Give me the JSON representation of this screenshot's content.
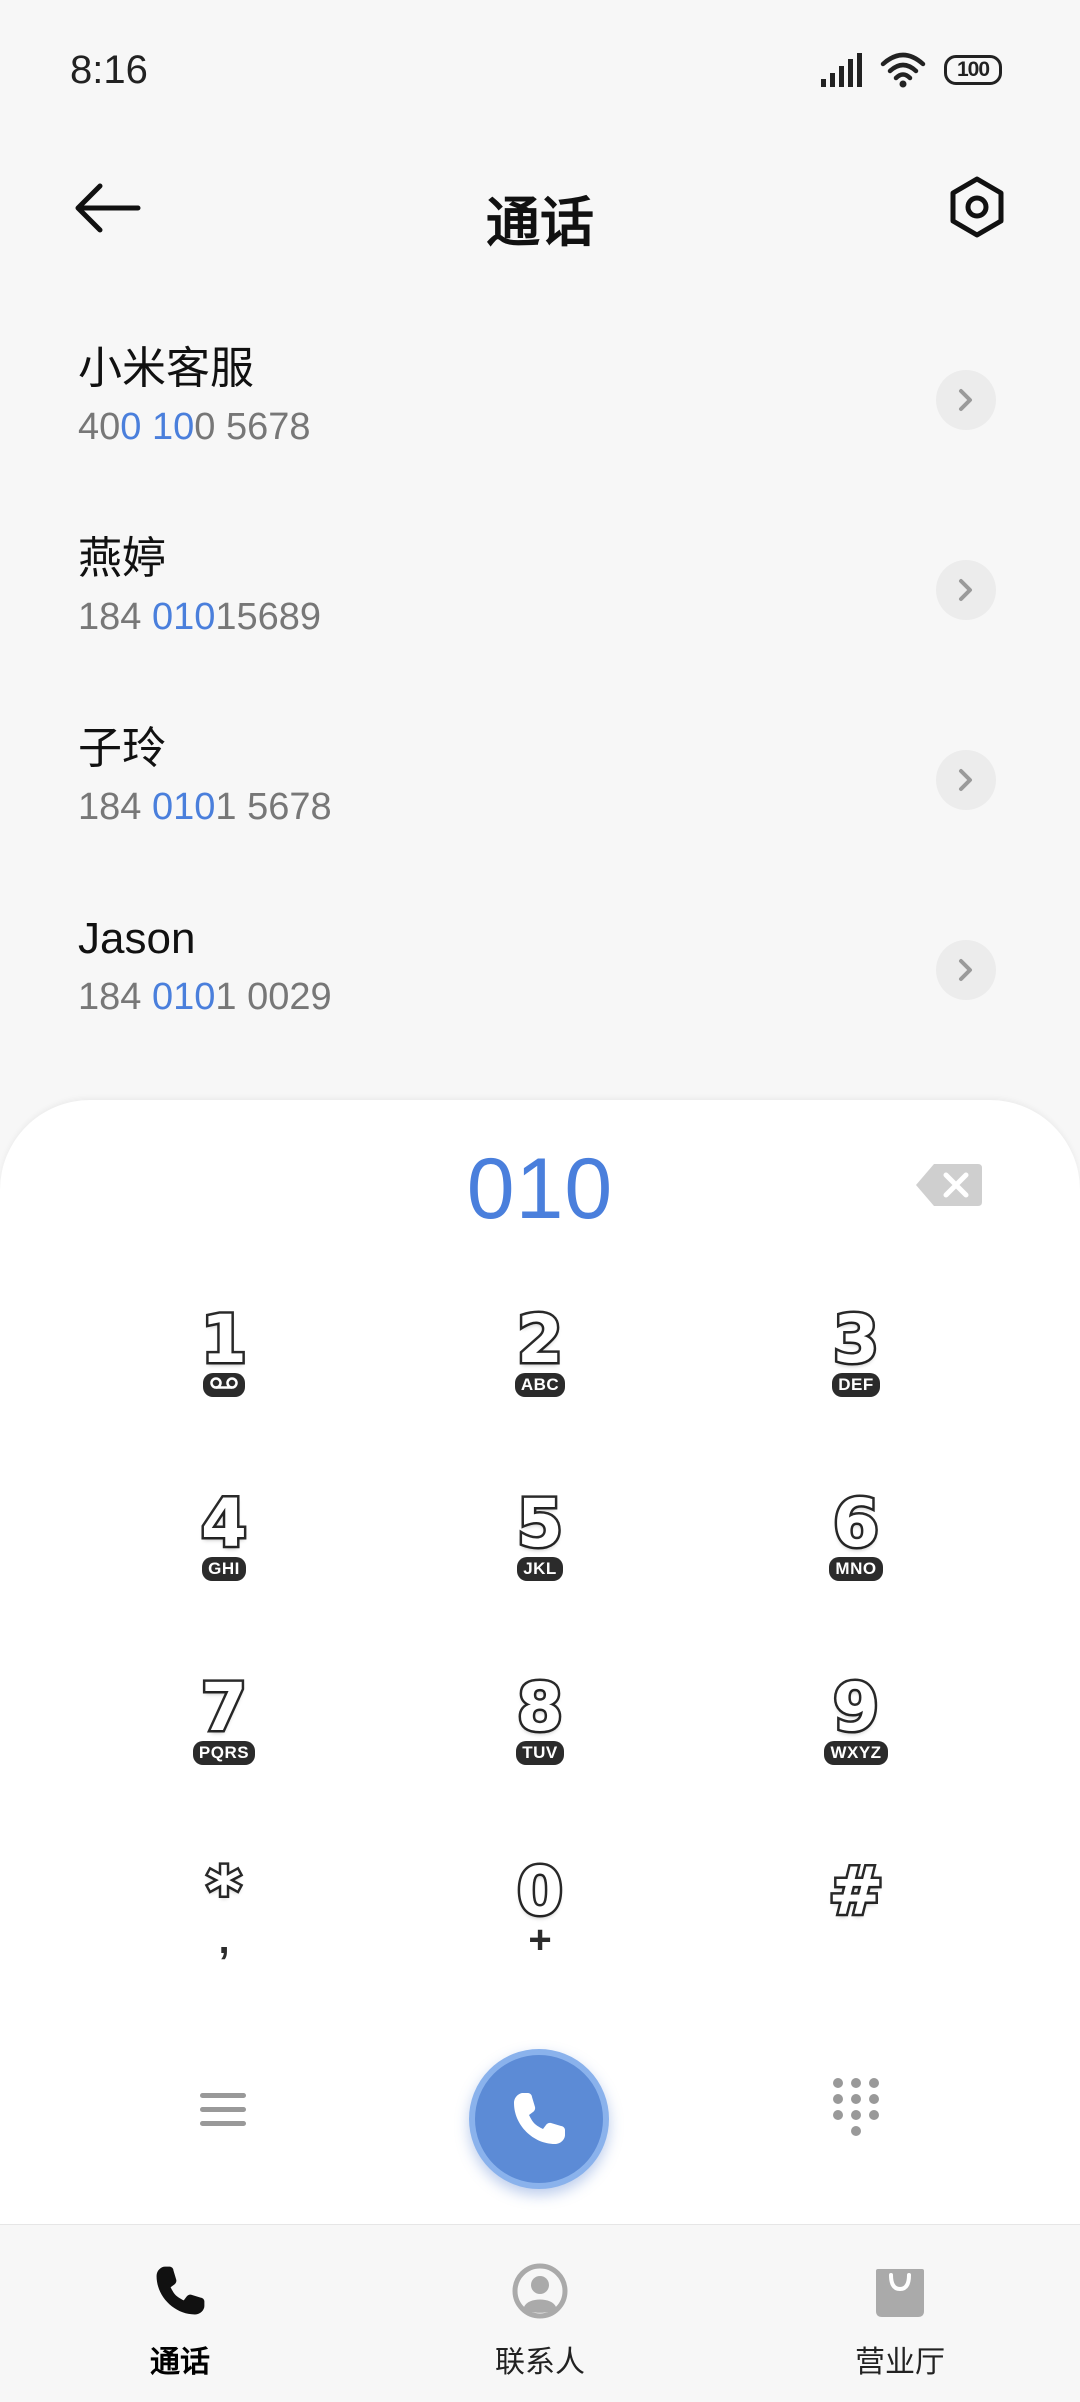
{
  "status_bar": {
    "time": "8:16",
    "battery": "100"
  },
  "header": {
    "title": "通话"
  },
  "results": [
    {
      "name": "小米客服",
      "number_parts": [
        "40",
        "0 10",
        "0 5678"
      ]
    },
    {
      "name": "燕婷",
      "number_parts": [
        "184 ",
        "010",
        "15689"
      ]
    },
    {
      "name": "子玲",
      "number_parts": [
        "184 ",
        "010",
        "1 5678"
      ]
    },
    {
      "name": "Jason",
      "number_parts": [
        "184 ",
        "010",
        "1 0029"
      ]
    }
  ],
  "dialer": {
    "input": "010",
    "keys": [
      {
        "digit": "1",
        "letters": "",
        "icon": "voicemail-icon"
      },
      {
        "digit": "2",
        "letters": "ABC"
      },
      {
        "digit": "3",
        "letters": "DEF"
      },
      {
        "digit": "4",
        "letters": "GHI"
      },
      {
        "digit": "5",
        "letters": "JKL"
      },
      {
        "digit": "6",
        "letters": "MNO"
      },
      {
        "digit": "7",
        "letters": "PQRS"
      },
      {
        "digit": "8",
        "letters": "TUV"
      },
      {
        "digit": "9",
        "letters": "WXYZ"
      },
      {
        "digit": "*",
        "sub": ","
      },
      {
        "digit": "0",
        "sub": "+"
      },
      {
        "digit": "#",
        "sub": ""
      }
    ]
  },
  "bottom_nav": [
    {
      "label": "通话",
      "icon": "phone-icon",
      "active": true
    },
    {
      "label": "联系人",
      "icon": "contact-icon",
      "active": false
    },
    {
      "label": "营业厅",
      "icon": "shopping-bag-icon",
      "active": false
    }
  ],
  "colors": {
    "accent": "#4a7fdc",
    "call_button": "#5c8bd6"
  }
}
